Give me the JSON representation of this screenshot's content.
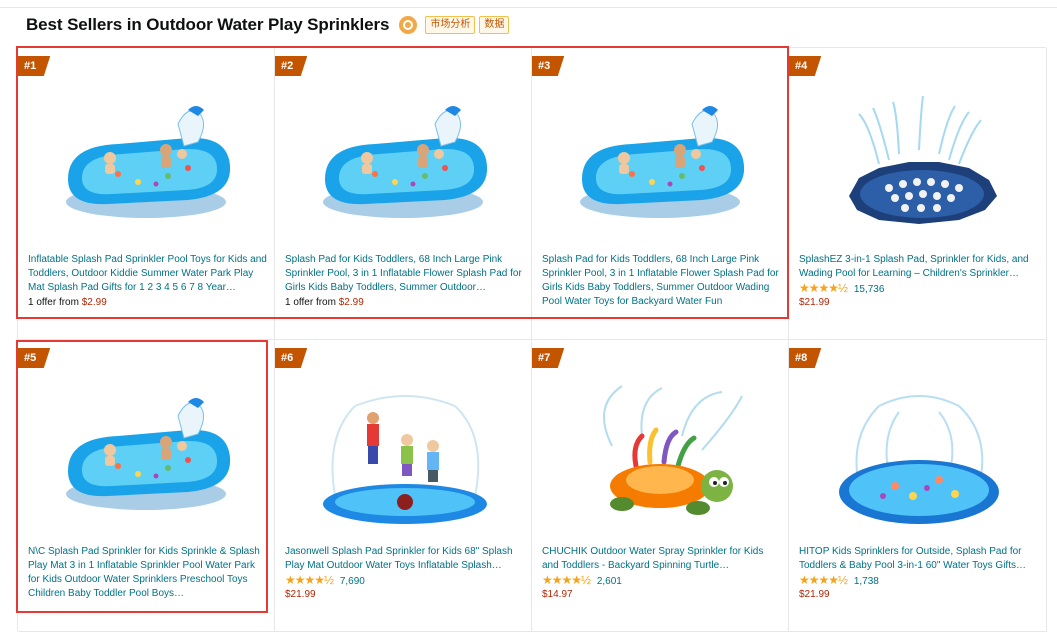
{
  "header": {
    "title": "Best Sellers in Outdoor Water Play Sprinklers",
    "tag1": "市场分析",
    "tag2": "数据"
  },
  "products": [
    {
      "rank": "#1",
      "title": "Inflatable Splash Pad Sprinkler Pool Toys for Kids and Toddlers, Outdoor Kiddie Summer Water Park Play Mat Splash Pad Gifts for 1 2 3 4 5 6 7 8 Year…",
      "offer_prefix": "1 offer from",
      "price": "$2.99",
      "image": "inflatable-pool-icon"
    },
    {
      "rank": "#2",
      "title": "Splash Pad for Kids Toddlers, 68 Inch Large Pink Sprinkler Pool, 3 in 1 Inflatable Flower Splash Pad for Girls Kids Baby Toddlers, Summer Outdoor…",
      "offer_prefix": "1 offer from",
      "price": "$2.99",
      "image": "inflatable-pool-icon"
    },
    {
      "rank": "#3",
      "title": "Splash Pad for Kids Toddlers, 68 Inch Large Pink Sprinkler Pool, 3 in 1 Inflatable Flower Splash Pad for Girls Kids Baby Toddlers, Summer Outdoor Wading Pool Water Toys for Backyard Water Fun",
      "image": "inflatable-pool-icon"
    },
    {
      "rank": "#4",
      "title": "SplashEZ 3-in-1 Splash Pad, Sprinkler for Kids, and Wading Pool for Learning – Children's Sprinkler…",
      "stars": "★★★★½",
      "rating": 4.5,
      "reviews": "15,736",
      "price": "$21.99",
      "image": "splash-mat-icon"
    },
    {
      "rank": "#5",
      "title": "N\\C Splash Pad Sprinkler for Kids Sprinkle & Splash Play Mat 3 in 1 Inflatable Sprinkler Pool Water Park for Kids Outdoor Water Sprinklers Preschool Toys Children Baby Toddler Pool Boys…",
      "image": "inflatable-pool-icon"
    },
    {
      "rank": "#6",
      "title": "Jasonwell Splash Pad Sprinkler for Kids 68\" Splash Play Mat Outdoor Water Toys Inflatable Splash…",
      "stars": "★★★★½",
      "rating": 4.5,
      "reviews": "7,690",
      "price": "$21.99",
      "image": "kids-splash-pad-icon"
    },
    {
      "rank": "#7",
      "title": "CHUCHIK Outdoor Water Spray Sprinkler for Kids and Toddlers - Backyard Spinning Turtle…",
      "stars": "★★★★½",
      "rating": 4.5,
      "reviews": "2,601",
      "price": "$14.97",
      "image": "turtle-sprinkler-icon"
    },
    {
      "rank": "#8",
      "title": "HITOP Kids Sprinklers for Outside, Splash Pad for Toddlers & Baby Pool 3-in-1 60\" Water Toys Gifts…",
      "stars": "★★★★½",
      "rating": 4.5,
      "reviews": "1,738",
      "price": "$21.99",
      "image": "round-splash-pad-icon"
    }
  ],
  "colors": {
    "highlight": "#e53935",
    "rank_badge": "#c45500",
    "link": "#007185",
    "price": "#b12704"
  }
}
